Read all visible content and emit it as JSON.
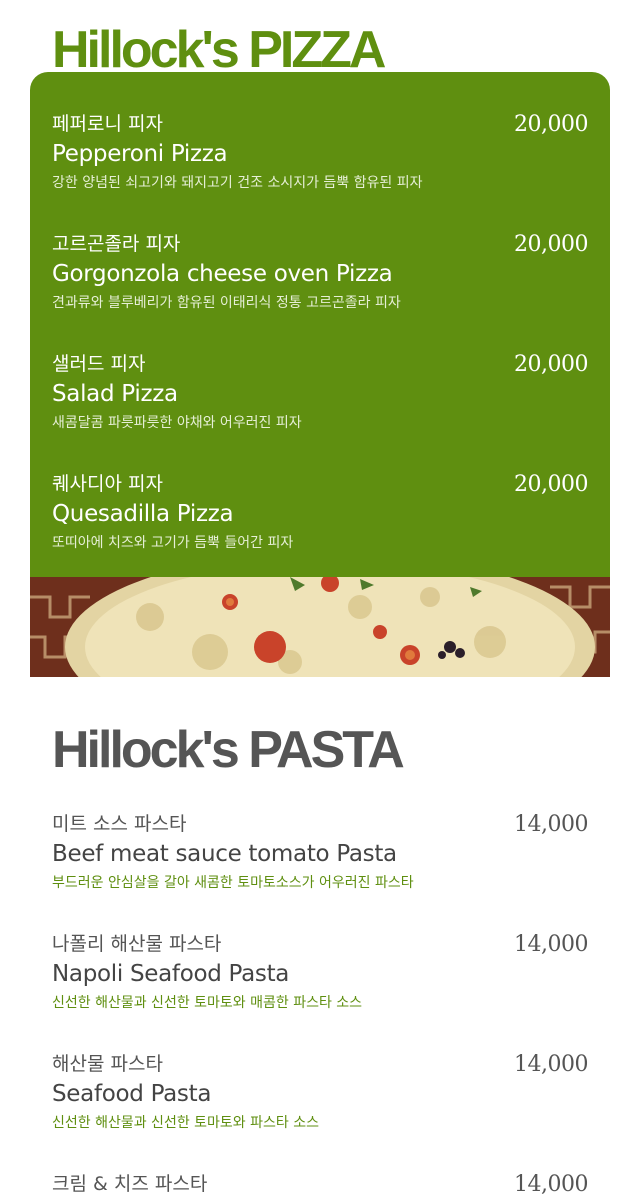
{
  "colors": {
    "accent_green": "#5f8f10",
    "heading_gray": "#555555"
  },
  "pizza": {
    "heading": "Hillock's PIZZA",
    "items": [
      {
        "ko": "페퍼로니 피자",
        "en": "Pepperoni Pizza",
        "desc": "강한 양념된 쇠고기와 돼지고기 건조 소시지가 듬뿍 함유된 피자",
        "price": "20,000"
      },
      {
        "ko": "고르곤졸라 피자",
        "en": "Gorgonzola cheese oven Pizza",
        "desc": "견과류와 블루베리가 함유된 이태리식 정통 고르곤졸라 피자",
        "price": "20,000"
      },
      {
        "ko": "샐러드 피자",
        "en": "Salad Pizza",
        "desc": "새콤달콤 파릇파릇한 야채와 어우러진 피자",
        "price": "20,000"
      },
      {
        "ko": "퀘사디아 피자",
        "en": "Quesadilla Pizza",
        "desc": "또띠아에 치즈와 고기가 듬뿍 들어간 피자",
        "price": "20,000"
      }
    ]
  },
  "pasta": {
    "heading": "Hillock's PASTA",
    "items": [
      {
        "ko": "미트 소스 파스타",
        "en": "Beef meat sauce tomato Pasta",
        "desc": "부드러운 안심살을 갈아 새콤한 토마토소스가 어우러진 파스타",
        "price": "14,000"
      },
      {
        "ko": "나폴리 해산물 파스타",
        "en": "Napoli Seafood Pasta",
        "desc": "신선한 해산물과 신선한 토마토와 매콤한 파스타 소스",
        "price": "14,000"
      },
      {
        "ko": "해산물 파스타",
        "en": "Seafood Pasta",
        "desc": "신선한 해산물과 신선한 토마토와 파스타 소스",
        "price": "14,000"
      },
      {
        "ko": "크림 & 치즈 파스타",
        "en": "",
        "desc": "",
        "price": "14,000"
      }
    ]
  }
}
